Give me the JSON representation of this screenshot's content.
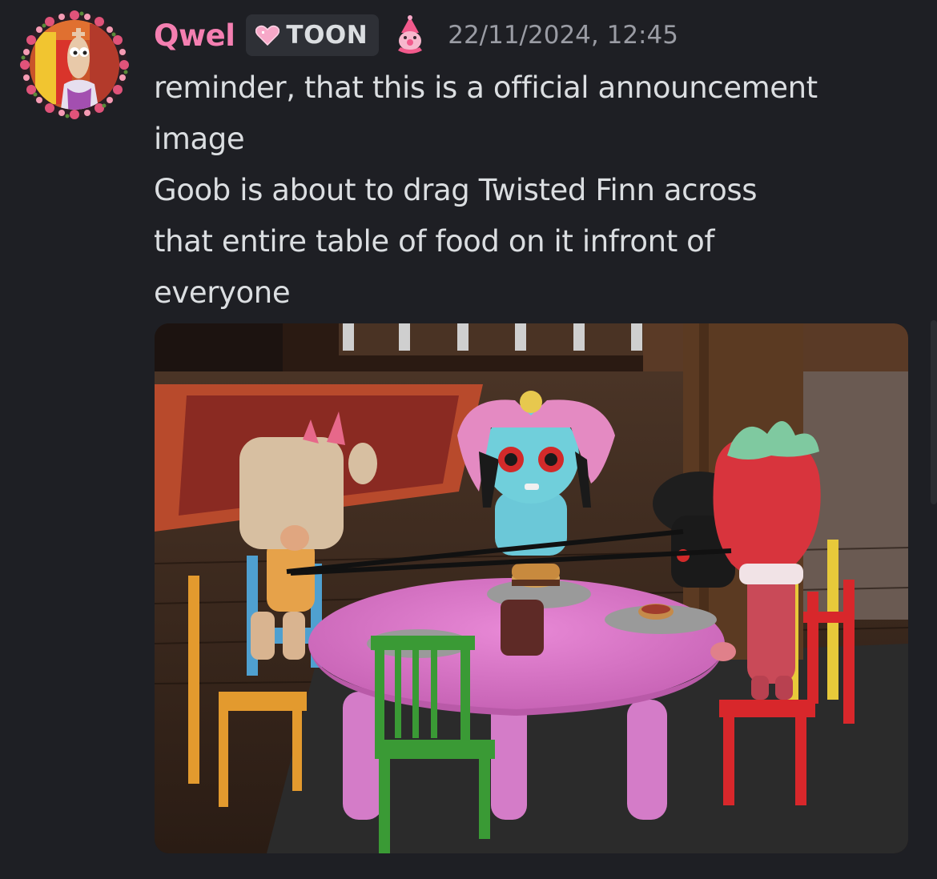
{
  "message": {
    "author": "Qwel",
    "tag": {
      "label": "TOON",
      "icon": "pink-heart-icon"
    },
    "role_icon": "clown-icon",
    "timestamp": "22/11/2024, 12:45",
    "lines": [
      "reminder, that this is a official announcement",
      "image",
      "Goob is about to drag Twisted Finn across",
      "that entire table of food on it infront of",
      "everyone"
    ],
    "attachment": {
      "type": "image"
    }
  },
  "colors": {
    "background": "#1e1f24",
    "username": "#f47fb1",
    "text": "#dbdee1",
    "timestamp": "#9a9ca4",
    "tag_bg": "#2e3036"
  }
}
